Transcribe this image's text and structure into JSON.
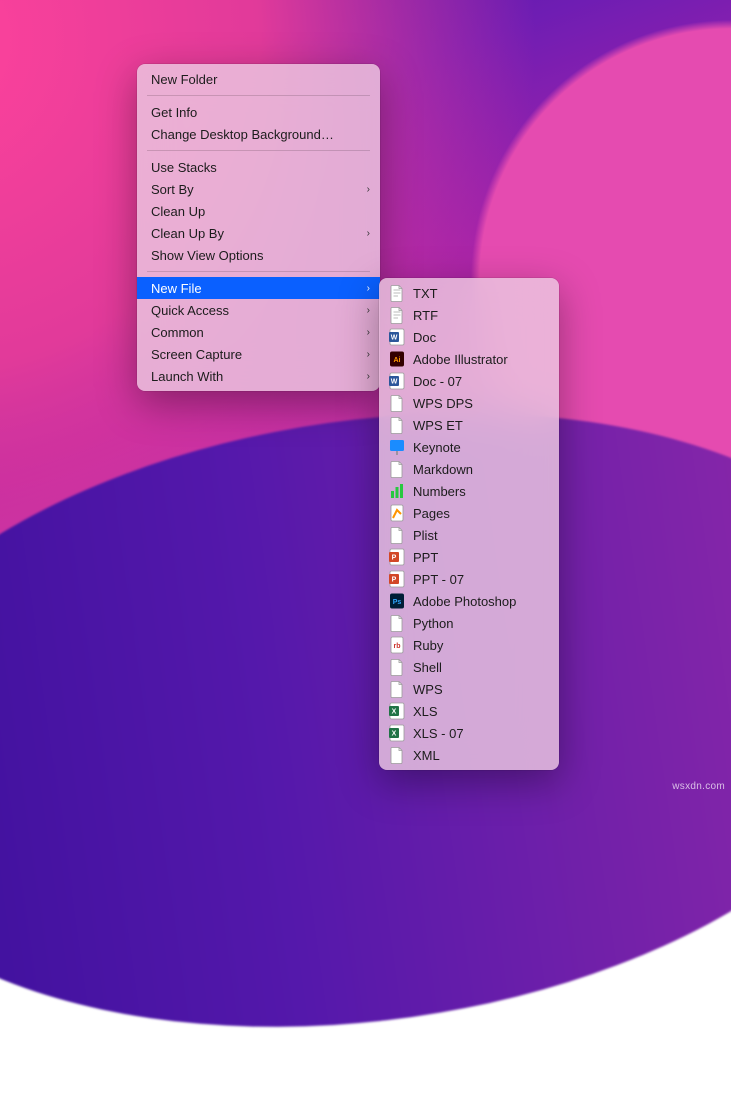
{
  "context_menu": {
    "groups": [
      [
        {
          "label": "New Folder",
          "submenu": false
        }
      ],
      [
        {
          "label": "Get Info",
          "submenu": false
        },
        {
          "label": "Change Desktop Background…",
          "submenu": false
        }
      ],
      [
        {
          "label": "Use Stacks",
          "submenu": false
        },
        {
          "label": "Sort By",
          "submenu": true
        },
        {
          "label": "Clean Up",
          "submenu": false
        },
        {
          "label": "Clean Up By",
          "submenu": true
        },
        {
          "label": "Show View Options",
          "submenu": false
        }
      ],
      [
        {
          "label": "New File",
          "submenu": true,
          "selected": true
        },
        {
          "label": "Quick Access",
          "submenu": true
        },
        {
          "label": "Common",
          "submenu": true
        },
        {
          "label": "Screen Capture",
          "submenu": true
        },
        {
          "label": "Launch With",
          "submenu": true
        }
      ]
    ]
  },
  "new_file_submenu": {
    "items": [
      {
        "label": "TXT",
        "icon": "txt"
      },
      {
        "label": "RTF",
        "icon": "rtf"
      },
      {
        "label": "Doc",
        "icon": "word"
      },
      {
        "label": "Adobe Illustrator",
        "icon": "ai"
      },
      {
        "label": "Doc - 07",
        "icon": "word"
      },
      {
        "label": "WPS DPS",
        "icon": "blank"
      },
      {
        "label": "WPS ET",
        "icon": "blank"
      },
      {
        "label": "Keynote",
        "icon": "keynote"
      },
      {
        "label": "Markdown",
        "icon": "blank"
      },
      {
        "label": "Numbers",
        "icon": "numbers"
      },
      {
        "label": "Pages",
        "icon": "pages"
      },
      {
        "label": "Plist",
        "icon": "blank"
      },
      {
        "label": "PPT",
        "icon": "ppt"
      },
      {
        "label": "PPT - 07",
        "icon": "ppt"
      },
      {
        "label": "Adobe Photoshop",
        "icon": "ps"
      },
      {
        "label": "Python",
        "icon": "blank"
      },
      {
        "label": "Ruby",
        "icon": "ruby"
      },
      {
        "label": "Shell",
        "icon": "blank"
      },
      {
        "label": "WPS",
        "icon": "blank"
      },
      {
        "label": "XLS",
        "icon": "xls"
      },
      {
        "label": "XLS - 07",
        "icon": "xls"
      },
      {
        "label": "XML",
        "icon": "blank"
      }
    ]
  },
  "icon_colors": {
    "word": "#2b579a",
    "ppt": "#d24726",
    "xls": "#217346",
    "ai": "#330000",
    "ps": "#001e36",
    "keynote": "#1a8cff",
    "numbers": "#28c840",
    "pages": "#ff9500",
    "ruby": "#ffffff",
    "blank": "#ffffff",
    "txt": "#ffffff",
    "rtf": "#ffffff"
  },
  "watermark": "wsxdn.com"
}
